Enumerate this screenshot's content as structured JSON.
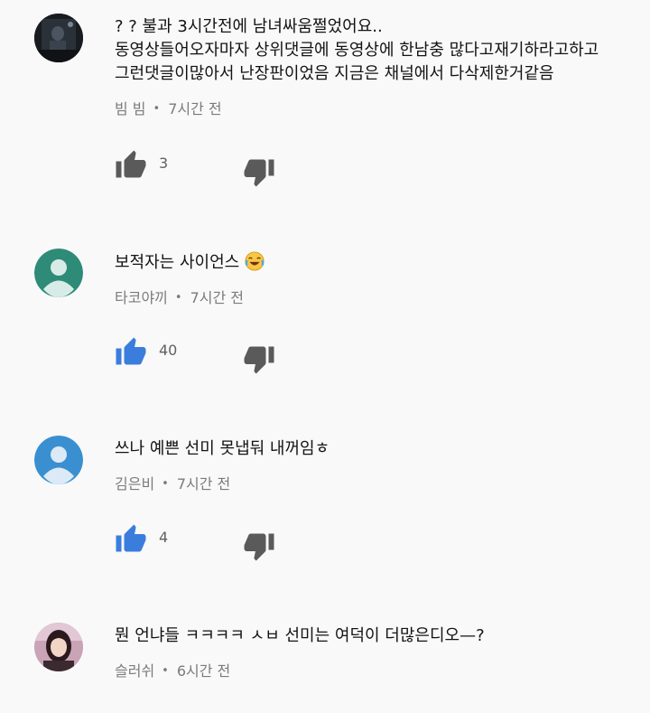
{
  "colors": {
    "background": "#f9f9f9",
    "like_active": "#3b7ddd",
    "icon_gray": "#5a5a5a",
    "avatar_teal": "#2e8b78",
    "avatar_blue": "#3a8fd0"
  },
  "comments": [
    {
      "lines": [
        "? ? 불과 3시간전에 남녀싸움쩔었어요..",
        "동영상들어오자마자 상위댓글에 동영상에 한남충 많다고재기하라고하고",
        "그런댓글이많아서 난장판이었음 지금은 채널에서 다삭제한거같음"
      ],
      "author": "빔 빔",
      "separator": "•",
      "time": "7시간 전",
      "likes": "3",
      "liked": false,
      "avatar_icon": "photo-avatar-dark"
    },
    {
      "lines": [
        "보적자는 사이언스"
      ],
      "author": "타코야끼",
      "separator": "•",
      "time": "7시간 전",
      "likes": "40",
      "liked": true,
      "avatar_icon": "default-user-avatar-teal",
      "trailing_emoji": "crying-laughing-face"
    },
    {
      "lines": [
        "쓰나 예쁜 선미 못냅둬 내꺼임ㅎ"
      ],
      "author": "김은비",
      "separator": "•",
      "time": "7시간 전",
      "likes": "4",
      "liked": true,
      "avatar_icon": "default-user-avatar-blue"
    },
    {
      "lines": [
        "뭔 언냐들 ㅋㅋㅋㅋ ㅅㅂ 선미는 여덕이 더많은디오—?"
      ],
      "author": "슬러쉬",
      "separator": "•",
      "time": "6시간 전",
      "avatar_icon": "photo-avatar-woman"
    }
  ]
}
